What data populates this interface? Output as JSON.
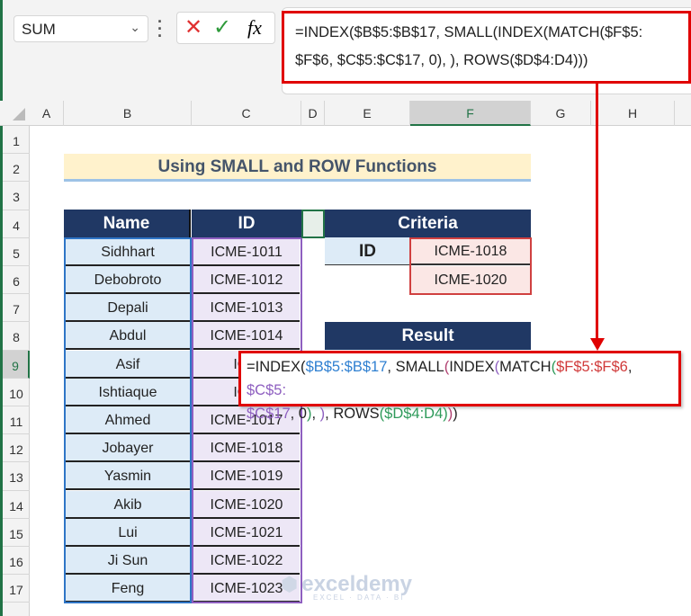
{
  "name_box": {
    "value": "SUM"
  },
  "formula_bar": {
    "cancel_icon": "x-icon",
    "enter_icon": "check-icon",
    "fx_label": "fx",
    "line1": "=INDEX($B$5:$B$17, SMALL(INDEX(MATCH($F$5:",
    "line2": "$F$6, $C$5:$C$17, 0), ), ROWS($D$4:D4)))"
  },
  "columns": [
    "A",
    "B",
    "C",
    "D",
    "E",
    "F",
    "G",
    "H"
  ],
  "selected_column": "F",
  "rows": [
    "1",
    "2",
    "3",
    "4",
    "5",
    "6",
    "7",
    "8",
    "9",
    "10",
    "11",
    "12",
    "13",
    "14",
    "15",
    "16",
    "17"
  ],
  "selected_row": "9",
  "sheet": {
    "title": "Using SMALL and ROW Functions",
    "table_headers": {
      "name": "Name",
      "id": "ID"
    },
    "table": [
      {
        "name": "Sidhhart",
        "id": "ICME-1011"
      },
      {
        "name": "Debobroto",
        "id": "ICME-1012"
      },
      {
        "name": "Depali",
        "id": "ICME-1013"
      },
      {
        "name": "Abdul",
        "id": "ICME-1014"
      },
      {
        "name": "Asif",
        "id": "ICM"
      },
      {
        "name": "Ishtiaque",
        "id": "ICM"
      },
      {
        "name": "Ahmed",
        "id": "ICME-1017"
      },
      {
        "name": "Jobayer",
        "id": "ICME-1018"
      },
      {
        "name": "Yasmin",
        "id": "ICME-1019"
      },
      {
        "name": "Akib",
        "id": "ICME-1020"
      },
      {
        "name": "Lui",
        "id": "ICME-1021"
      },
      {
        "name": "Ji Sun",
        "id": "ICME-1022"
      },
      {
        "name": "Feng",
        "id": "ICME-1023"
      }
    ],
    "criteria": {
      "header": "Criteria",
      "label": "ID",
      "values": [
        "ICME-1018",
        "ICME-1020"
      ]
    },
    "result": {
      "header": "Result"
    }
  },
  "callout": {
    "segments": [
      {
        "t": "=INDEX(",
        "c": "#222222"
      },
      {
        "t": "$B$5:$B$17",
        "c": "#2e7fd1"
      },
      {
        "t": ", SMALL",
        "c": "#222222"
      },
      {
        "t": "(",
        "c": "#b04070"
      },
      {
        "t": "INDEX",
        "c": "#222222"
      },
      {
        "t": "(",
        "c": "#8e5fc0"
      },
      {
        "t": "MATCH",
        "c": "#222222"
      },
      {
        "t": "(",
        "c": "#2e9a5a"
      },
      {
        "t": "$F$5:$F$6",
        "c": "#d03a3a"
      },
      {
        "t": ", ",
        "c": "#222222"
      },
      {
        "t": "$C$5:",
        "c": "#8e5fc0"
      },
      {
        "t": "$C$17",
        "c": "#8e5fc0",
        "br": true
      },
      {
        "t": ", 0",
        "c": "#222222"
      },
      {
        "t": ")",
        "c": "#2e9a5a"
      },
      {
        "t": ", ",
        "c": "#222222"
      },
      {
        "t": ")",
        "c": "#8e5fc0"
      },
      {
        "t": ", ROWS",
        "c": "#222222"
      },
      {
        "t": "(",
        "c": "#2e9a5a"
      },
      {
        "t": "$D$4:D4",
        "c": "#2e9a5a"
      },
      {
        "t": ")",
        "c": "#2e9a5a"
      },
      {
        "t": ")",
        "c": "#b04070"
      },
      {
        "t": ")",
        "c": "#222222"
      }
    ]
  },
  "watermark": {
    "brand": "exceldemy",
    "tagline": "EXCEL · DATA · BI"
  },
  "colors": {
    "header": "#203864",
    "accent": "#e00000",
    "excel_green": "#217346"
  }
}
